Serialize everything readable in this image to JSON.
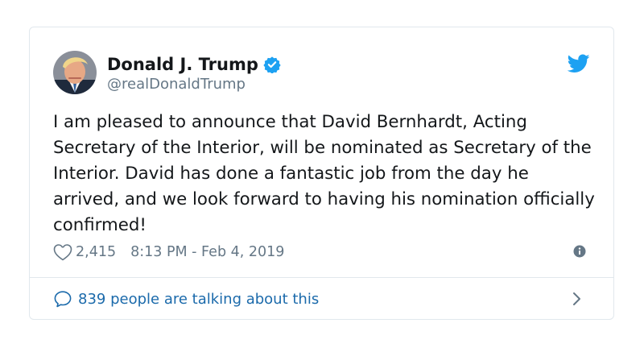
{
  "tweet": {
    "author": {
      "display_name": "Donald J. Trump",
      "handle": "@realDonaldTrump",
      "verified": true,
      "avatar_icon": "profile-photo"
    },
    "brand_icon": "twitter-bird-icon",
    "text": "I am pleased to announce that David Bernhardt, Acting Secretary of the Interior, will be nominated as Secretary of the Interior. David has done a fantastic job from the day he arrived, and we look forward to having his nomination officially confirmed!",
    "likes": "2,415",
    "timestamp": "8:13 PM - Feb 4, 2019",
    "footer_text": "839 people are talking about this"
  },
  "colors": {
    "text": "#14171a",
    "muted": "#657786",
    "link": "#1b6aab",
    "brand": "#1da1f2",
    "border": "#e1e8ed"
  }
}
